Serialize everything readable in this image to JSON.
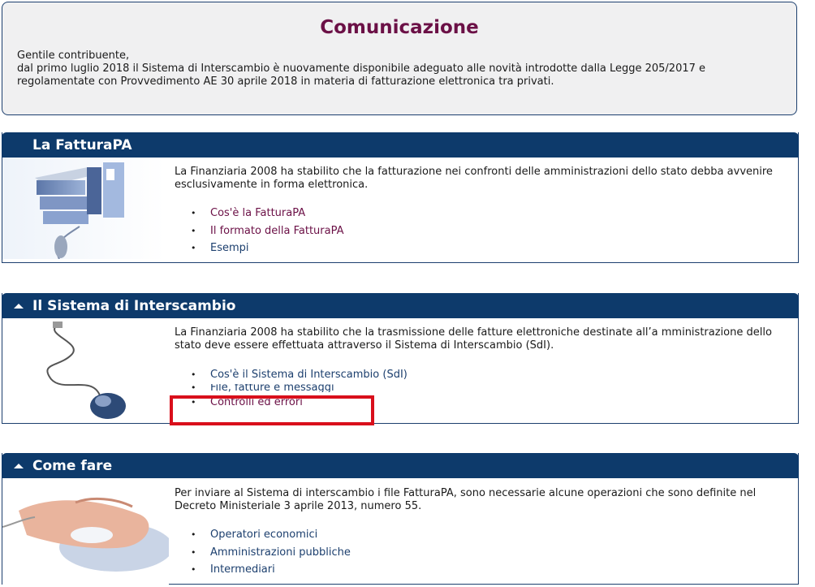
{
  "communication": {
    "title": "Comunicazione",
    "greeting": "Gentile contribuente,",
    "line1": "dal primo luglio 2018 il Sistema di Interscambio è nuovamente disponibile adeguato alle novità introdotte dalla Legge 205/2017 e",
    "line2": "regolamentate con Provvedimento AE 30 aprile 2018 in materia di fatturazione elettronica tra privati."
  },
  "fatturapa": {
    "title": "La FatturaPA",
    "description": "La Finanziaria 2008 ha stabilito che la fatturazione nei confronti delle amministrazioni dello stato debba avvenire esclusivamente in forma elettronica.",
    "links": [
      "Cos'è la FatturaPA",
      "Il formato della FatturaPA",
      "Esempi"
    ]
  },
  "sdi": {
    "title": "Il Sistema di Interscambio",
    "description": "La Finanziaria 2008 ha stabilito che la trasmissione delle fatture elettroniche destinate all’a mministrazione dello stato deve essere effettuata attraverso il Sistema di Interscambio (SdI).",
    "links": [
      "Cos'è il Sistema di Interscambio (SdI)",
      "File, fatture e messaggi",
      "Controlli ed errori"
    ]
  },
  "comefare": {
    "title": "Come fare",
    "description": "Per inviare al Sistema di interscambio i file FatturaPA, sono necessarie alcune operazioni che sono definite nel Decreto Ministeriale 3 aprile 2013, numero 55.",
    "links": [
      "Operatori economici",
      "Amministrazioni pubbliche",
      "Intermediari"
    ]
  },
  "colors": {
    "header_bg": "#0d3a6b",
    "title_color": "#6b1046",
    "highlight": "#d90f1b"
  }
}
